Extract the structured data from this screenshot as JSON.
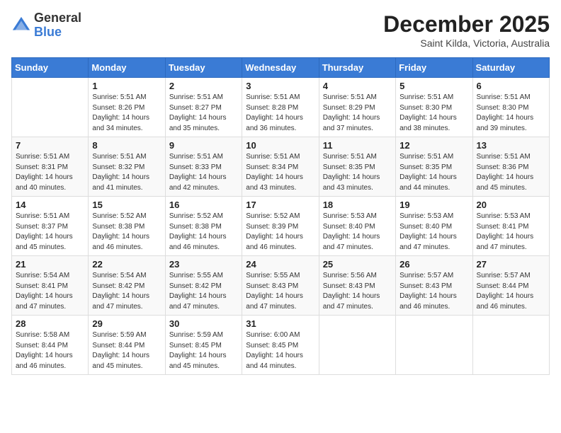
{
  "logo": {
    "general": "General",
    "blue": "Blue"
  },
  "title": {
    "month": "December 2025",
    "location": "Saint Kilda, Victoria, Australia"
  },
  "weekdays": [
    "Sunday",
    "Monday",
    "Tuesday",
    "Wednesday",
    "Thursday",
    "Friday",
    "Saturday"
  ],
  "weeks": [
    [
      {
        "day": "",
        "info": ""
      },
      {
        "day": "1",
        "info": "Sunrise: 5:51 AM\nSunset: 8:26 PM\nDaylight: 14 hours\nand 34 minutes."
      },
      {
        "day": "2",
        "info": "Sunrise: 5:51 AM\nSunset: 8:27 PM\nDaylight: 14 hours\nand 35 minutes."
      },
      {
        "day": "3",
        "info": "Sunrise: 5:51 AM\nSunset: 8:28 PM\nDaylight: 14 hours\nand 36 minutes."
      },
      {
        "day": "4",
        "info": "Sunrise: 5:51 AM\nSunset: 8:29 PM\nDaylight: 14 hours\nand 37 minutes."
      },
      {
        "day": "5",
        "info": "Sunrise: 5:51 AM\nSunset: 8:30 PM\nDaylight: 14 hours\nand 38 minutes."
      },
      {
        "day": "6",
        "info": "Sunrise: 5:51 AM\nSunset: 8:30 PM\nDaylight: 14 hours\nand 39 minutes."
      }
    ],
    [
      {
        "day": "7",
        "info": "Sunrise: 5:51 AM\nSunset: 8:31 PM\nDaylight: 14 hours\nand 40 minutes."
      },
      {
        "day": "8",
        "info": "Sunrise: 5:51 AM\nSunset: 8:32 PM\nDaylight: 14 hours\nand 41 minutes."
      },
      {
        "day": "9",
        "info": "Sunrise: 5:51 AM\nSunset: 8:33 PM\nDaylight: 14 hours\nand 42 minutes."
      },
      {
        "day": "10",
        "info": "Sunrise: 5:51 AM\nSunset: 8:34 PM\nDaylight: 14 hours\nand 43 minutes."
      },
      {
        "day": "11",
        "info": "Sunrise: 5:51 AM\nSunset: 8:35 PM\nDaylight: 14 hours\nand 43 minutes."
      },
      {
        "day": "12",
        "info": "Sunrise: 5:51 AM\nSunset: 8:35 PM\nDaylight: 14 hours\nand 44 minutes."
      },
      {
        "day": "13",
        "info": "Sunrise: 5:51 AM\nSunset: 8:36 PM\nDaylight: 14 hours\nand 45 minutes."
      }
    ],
    [
      {
        "day": "14",
        "info": "Sunrise: 5:51 AM\nSunset: 8:37 PM\nDaylight: 14 hours\nand 45 minutes."
      },
      {
        "day": "15",
        "info": "Sunrise: 5:52 AM\nSunset: 8:38 PM\nDaylight: 14 hours\nand 46 minutes."
      },
      {
        "day": "16",
        "info": "Sunrise: 5:52 AM\nSunset: 8:38 PM\nDaylight: 14 hours\nand 46 minutes."
      },
      {
        "day": "17",
        "info": "Sunrise: 5:52 AM\nSunset: 8:39 PM\nDaylight: 14 hours\nand 46 minutes."
      },
      {
        "day": "18",
        "info": "Sunrise: 5:53 AM\nSunset: 8:40 PM\nDaylight: 14 hours\nand 47 minutes."
      },
      {
        "day": "19",
        "info": "Sunrise: 5:53 AM\nSunset: 8:40 PM\nDaylight: 14 hours\nand 47 minutes."
      },
      {
        "day": "20",
        "info": "Sunrise: 5:53 AM\nSunset: 8:41 PM\nDaylight: 14 hours\nand 47 minutes."
      }
    ],
    [
      {
        "day": "21",
        "info": "Sunrise: 5:54 AM\nSunset: 8:41 PM\nDaylight: 14 hours\nand 47 minutes."
      },
      {
        "day": "22",
        "info": "Sunrise: 5:54 AM\nSunset: 8:42 PM\nDaylight: 14 hours\nand 47 minutes."
      },
      {
        "day": "23",
        "info": "Sunrise: 5:55 AM\nSunset: 8:42 PM\nDaylight: 14 hours\nand 47 minutes."
      },
      {
        "day": "24",
        "info": "Sunrise: 5:55 AM\nSunset: 8:43 PM\nDaylight: 14 hours\nand 47 minutes."
      },
      {
        "day": "25",
        "info": "Sunrise: 5:56 AM\nSunset: 8:43 PM\nDaylight: 14 hours\nand 47 minutes."
      },
      {
        "day": "26",
        "info": "Sunrise: 5:57 AM\nSunset: 8:43 PM\nDaylight: 14 hours\nand 46 minutes."
      },
      {
        "day": "27",
        "info": "Sunrise: 5:57 AM\nSunset: 8:44 PM\nDaylight: 14 hours\nand 46 minutes."
      }
    ],
    [
      {
        "day": "28",
        "info": "Sunrise: 5:58 AM\nSunset: 8:44 PM\nDaylight: 14 hours\nand 46 minutes."
      },
      {
        "day": "29",
        "info": "Sunrise: 5:59 AM\nSunset: 8:44 PM\nDaylight: 14 hours\nand 45 minutes."
      },
      {
        "day": "30",
        "info": "Sunrise: 5:59 AM\nSunset: 8:45 PM\nDaylight: 14 hours\nand 45 minutes."
      },
      {
        "day": "31",
        "info": "Sunrise: 6:00 AM\nSunset: 8:45 PM\nDaylight: 14 hours\nand 44 minutes."
      },
      {
        "day": "",
        "info": ""
      },
      {
        "day": "",
        "info": ""
      },
      {
        "day": "",
        "info": ""
      }
    ]
  ]
}
